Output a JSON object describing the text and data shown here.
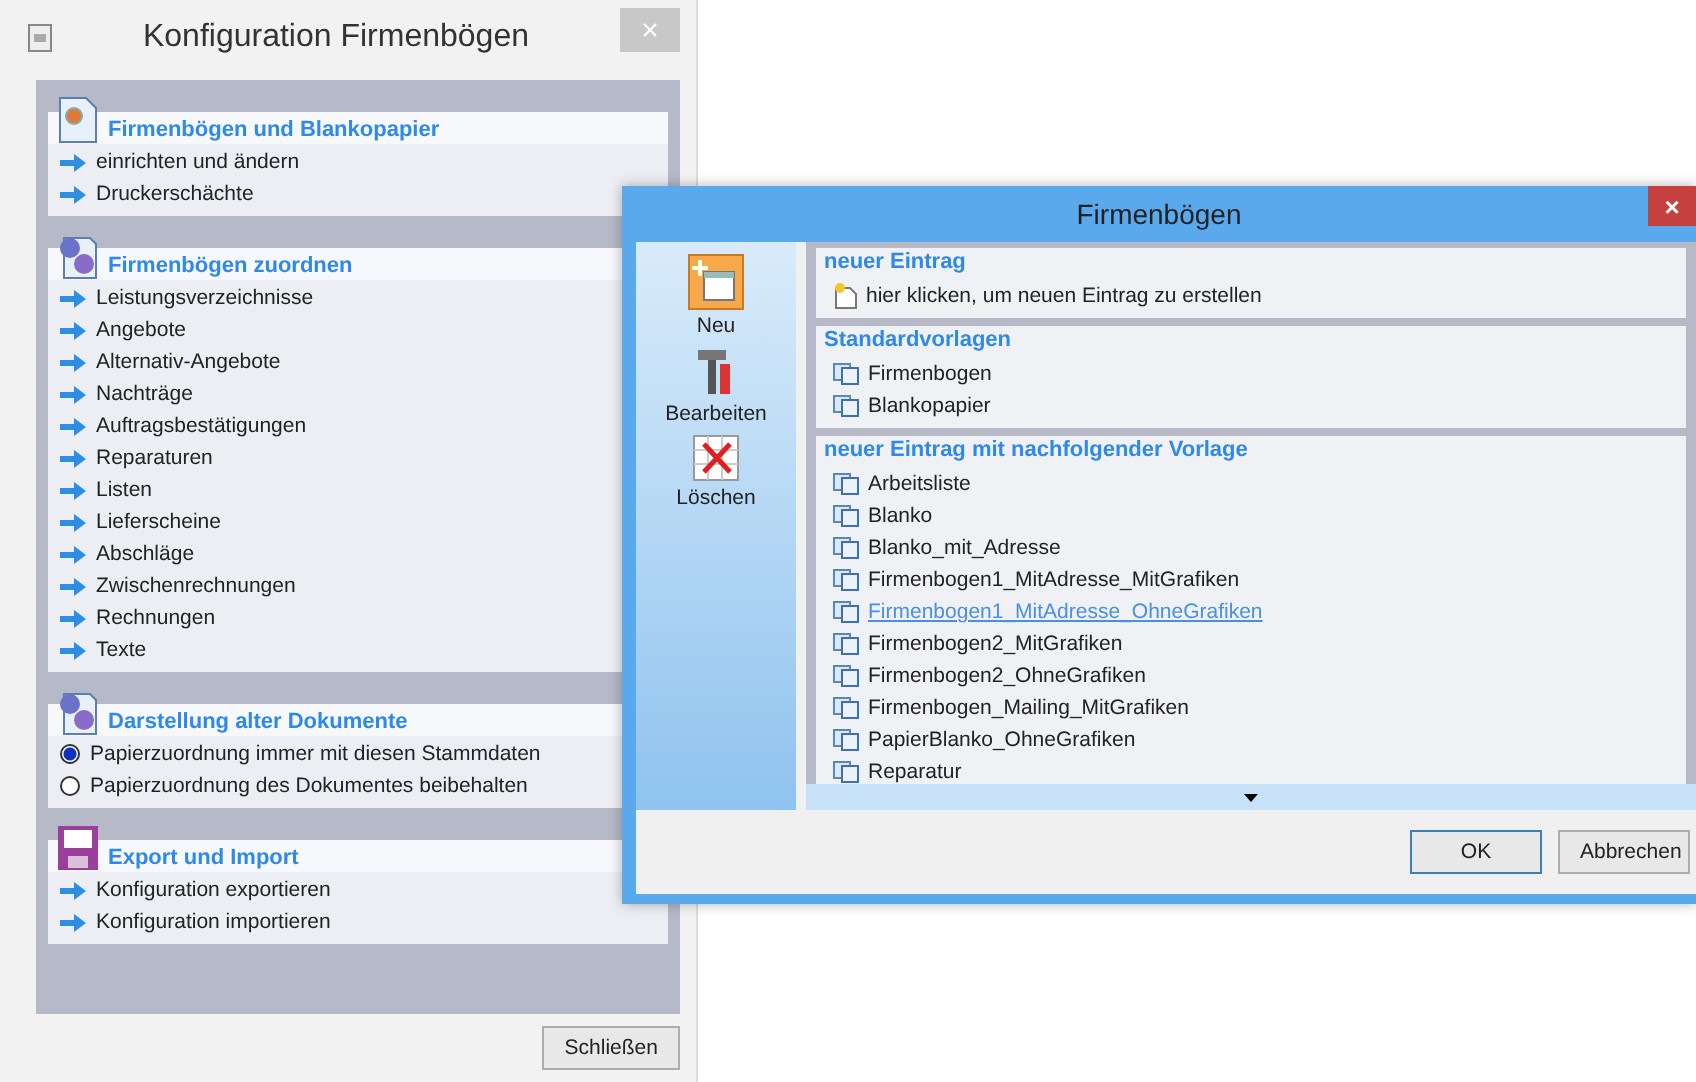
{
  "config_window": {
    "title": "Konfiguration Firmenbögen",
    "close": "×",
    "sections": [
      {
        "title": "Firmenbögen und Blankopapier",
        "kind": "links",
        "items": [
          {
            "label": "einrichten und ändern"
          },
          {
            "label": "Druckerschächte"
          }
        ]
      },
      {
        "title": "Firmenbögen zuordnen",
        "kind": "links",
        "items": [
          {
            "label": "Leistungsverzeichnisse"
          },
          {
            "label": "Angebote"
          },
          {
            "label": "Alternativ-Angebote"
          },
          {
            "label": "Nachträge"
          },
          {
            "label": "Auftragsbestätigungen"
          },
          {
            "label": "Reparaturen"
          },
          {
            "label": "Listen"
          },
          {
            "label": "Lieferscheine"
          },
          {
            "label": "Abschläge"
          },
          {
            "label": "Zwischenrechnungen"
          },
          {
            "label": "Rechnungen"
          },
          {
            "label": "Texte"
          }
        ]
      },
      {
        "title": "Darstellung alter Dokumente",
        "kind": "radios",
        "items": [
          {
            "label": "Papierzuordnung immer mit diesen Stammdaten",
            "selected": true
          },
          {
            "label": "Papierzuordnung des Dokumentes beibehalten",
            "selected": false
          }
        ]
      },
      {
        "title": "Export und Import",
        "kind": "links",
        "items": [
          {
            "label": "Konfiguration exportieren"
          },
          {
            "label": "Konfiguration importieren"
          }
        ]
      }
    ],
    "close_button": "Schließen"
  },
  "dialog": {
    "title": "Firmenbögen",
    "close": "×",
    "tools": [
      {
        "label": "Neu",
        "kind": "new"
      },
      {
        "label": "Bearbeiten",
        "kind": "edit"
      },
      {
        "label": "Löschen",
        "kind": "delete"
      }
    ],
    "groups": [
      {
        "title": "neuer Eintrag",
        "items": [
          {
            "label": "hier klicken, um neuen Eintrag zu erstellen",
            "kind": "new",
            "hovered": false
          }
        ]
      },
      {
        "title": "Standardvorlagen",
        "items": [
          {
            "label": "Firmenbogen",
            "kind": "template",
            "hovered": false
          },
          {
            "label": "Blankopapier",
            "kind": "template",
            "hovered": false
          }
        ]
      },
      {
        "title": "neuer Eintrag mit nachfolgender Vorlage",
        "items": [
          {
            "label": "Arbeitsliste",
            "kind": "template",
            "hovered": false
          },
          {
            "label": "Blanko",
            "kind": "template",
            "hovered": false
          },
          {
            "label": "Blanko_mit_Adresse",
            "kind": "template",
            "hovered": false
          },
          {
            "label": "Firmenbogen1_MitAdresse_MitGrafiken",
            "kind": "template",
            "hovered": false
          },
          {
            "label": "Firmenbogen1_MitAdresse_OhneGrafiken",
            "kind": "template",
            "hovered": true
          },
          {
            "label": "Firmenbogen2_MitGrafiken",
            "kind": "template",
            "hovered": false
          },
          {
            "label": "Firmenbogen2_OhneGrafiken",
            "kind": "template",
            "hovered": false
          },
          {
            "label": "Firmenbogen_Mailing_MitGrafiken",
            "kind": "template",
            "hovered": false
          },
          {
            "label": "PapierBlanko_OhneGrafiken",
            "kind": "template",
            "hovered": false
          },
          {
            "label": "Reparatur",
            "kind": "template",
            "hovered": false
          }
        ]
      }
    ],
    "buttons": [
      "OK",
      "Abbrechen"
    ]
  }
}
